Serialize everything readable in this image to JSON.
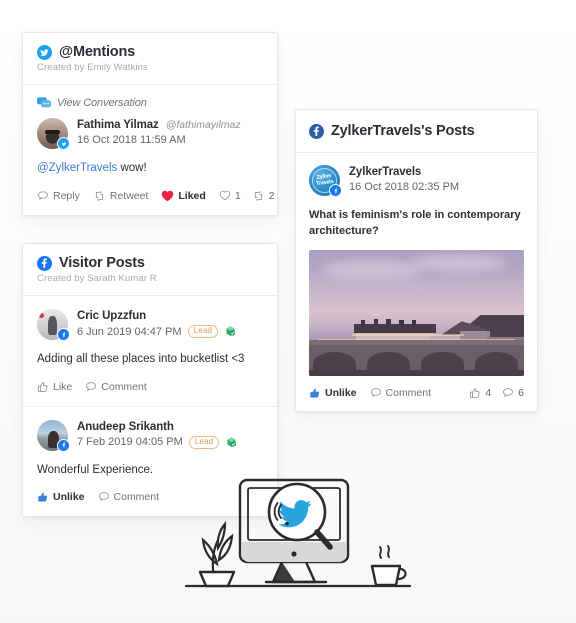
{
  "cards": {
    "mentions": {
      "icon": "twitter-icon",
      "title": "@Mentions",
      "subtitle": "Created by Emily Watkins",
      "conversation_link": "View Conversation",
      "conversation_icon": "speech-bubbles-icon",
      "post": {
        "author": "Fathima Yilmaz",
        "handle": "@fathimayilmaz",
        "timestamp": "16 Oct 2018 11:59 AM",
        "avatar": "fathima-avatar",
        "network_badge": "twitter-badge-icon",
        "text_mention": "@ZylkerTravels",
        "text_body": " wow!",
        "actions": [
          {
            "label": "Reply",
            "icon": "reply-icon",
            "state": "off"
          },
          {
            "label": "Retweet",
            "icon": "retweet-icon",
            "state": "off"
          },
          {
            "label": "Liked",
            "icon": "heart-filled-icon",
            "state": "on"
          }
        ],
        "counts": [
          {
            "icon": "heart-outline-icon",
            "value": "1"
          },
          {
            "icon": "retweet-icon",
            "value": "2"
          }
        ]
      }
    },
    "visitor": {
      "icon": "facebook-icon",
      "title": "Visitor Posts",
      "subtitle": "Created by Sarath Kumar R",
      "posts": [
        {
          "author": "Cric Upzzfun",
          "timestamp": "6 Jun 2019 04:47 PM",
          "badge": "Lead",
          "crm_icon": "crm-deal-icon",
          "avatar": "cric-avatar",
          "network_badge": "facebook-badge-icon",
          "text": "Adding all these places into bucketlist <3",
          "actions": [
            {
              "label": "Like",
              "icon": "thumb-up-outline-icon",
              "state": "off"
            },
            {
              "label": "Comment",
              "icon": "comment-icon",
              "state": "off"
            }
          ]
        },
        {
          "author": "Anudeep Srikanth",
          "timestamp": "7 Feb 2019 04:05 PM",
          "badge": "Lead",
          "crm_icon": "crm-deal-icon",
          "avatar": "anudeep-avatar",
          "network_badge": "facebook-badge-icon",
          "text": "Wonderful Experience.",
          "actions": [
            {
              "label": "Unlike",
              "icon": "thumb-up-filled-icon",
              "state": "on"
            },
            {
              "label": "Comment",
              "icon": "comment-icon",
              "state": "off"
            }
          ]
        }
      ]
    },
    "fbposts": {
      "icon": "facebook-icon",
      "title": "ZylkerTravels's Posts",
      "post": {
        "author": "ZylkerTravels",
        "timestamp": "16 Oct 2018 02:35 PM",
        "avatar": "zylkertravels-logo",
        "avatar_text": "Zylker Travels",
        "network_badge": "facebook-badge-icon",
        "text": "What is feminism's role in contemporary architecture?",
        "image_alt": "city-bridge-at-dusk-photo",
        "actions": [
          {
            "label": "Unlike",
            "icon": "thumb-up-filled-icon",
            "state": "on"
          },
          {
            "label": "Comment",
            "icon": "comment-icon",
            "state": "off"
          }
        ],
        "counts": [
          {
            "icon": "thumb-up-outline-icon",
            "value": "4"
          },
          {
            "icon": "comment-icon",
            "value": "6"
          }
        ]
      }
    }
  },
  "illustration": {
    "name": "monitor-with-magnifier-twitter-illustration",
    "elements": [
      "desktop-monitor",
      "magnifying-glass",
      "twitter-bird",
      "potted-plant",
      "coffee-cup",
      "desk-line"
    ]
  },
  "colors": {
    "twitter_blue": "#1da1f2",
    "facebook_blue": "#1877f2",
    "like_red": "#e8253a",
    "lead_orange": "#e89a4a",
    "text_dark": "#2b2f33",
    "text_muted": "#8d9196",
    "card_border": "#e6e7ea"
  }
}
